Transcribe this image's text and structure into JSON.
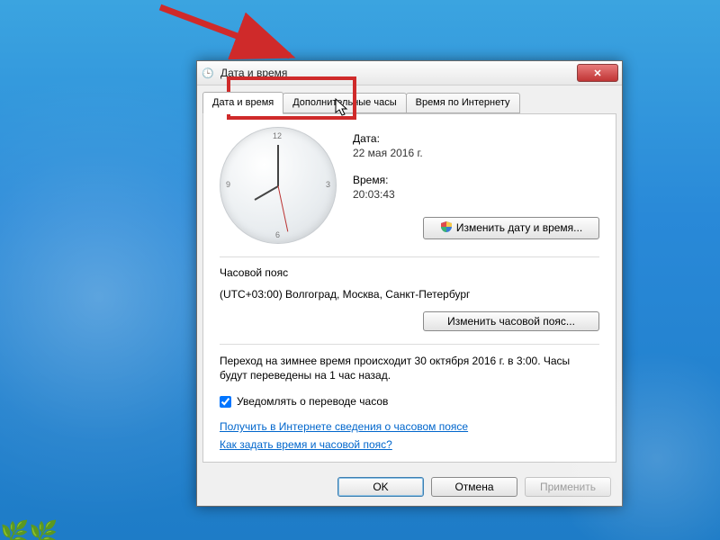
{
  "window": {
    "title": "Дата и время"
  },
  "tabs": [
    "Дата и время",
    "Дополнительные часы",
    "Время по Интернету"
  ],
  "date": {
    "label": "Дата:",
    "value": "22 мая 2016 г."
  },
  "time": {
    "label": "Время:",
    "value": "20:03:43"
  },
  "btn_change_dt": "Изменить дату и время...",
  "tz": {
    "label": "Часовой пояс",
    "value": "(UTC+03:00) Волгоград, Москва, Санкт-Петербург"
  },
  "btn_change_tz": "Изменить часовой пояс...",
  "dst_msg": "Переход на зимнее время происходит 30 октября 2016 г. в 3:00. Часы будут переведены на 1 час назад.",
  "notify_label": "Уведомлять о переводе часов",
  "notify_checked": true,
  "link_tz_online": "Получить в Интернете сведения о часовом поясе",
  "link_howto": "Как задать время и часовой пояс?",
  "buttons": {
    "ok": "OK",
    "cancel": "Отмена",
    "apply": "Применить"
  },
  "highlight": {
    "target_tab_index": 2,
    "color": "#cf2a2a"
  }
}
